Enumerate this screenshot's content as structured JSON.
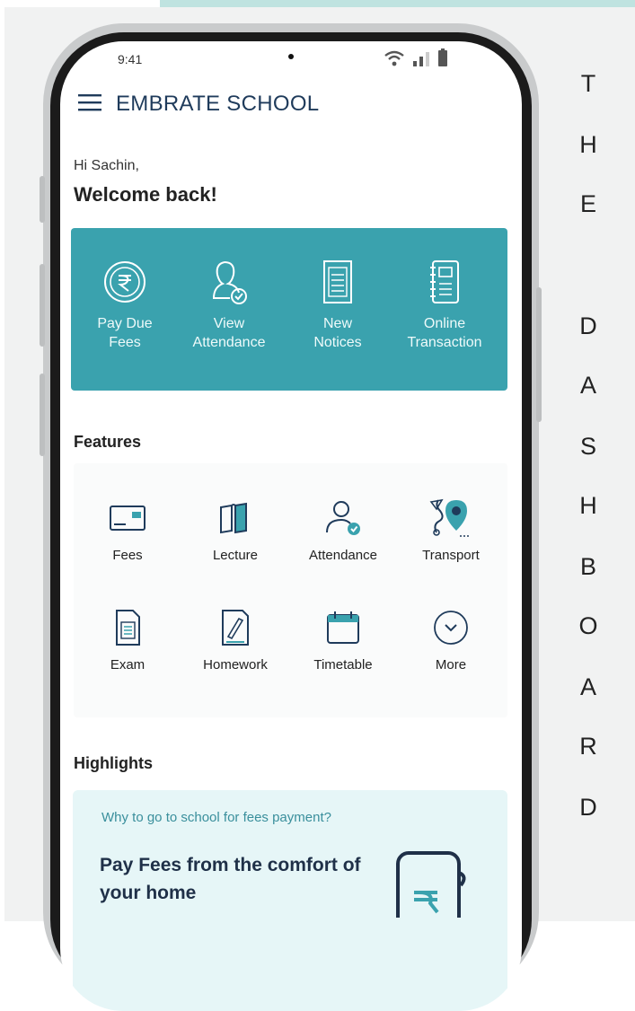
{
  "status_bar": {
    "time": "9:41"
  },
  "app": {
    "title": "EMBRATE SCHOOL"
  },
  "greeting": {
    "hi": "Hi Sachin,",
    "welcome": "Welcome back!"
  },
  "quick_actions": [
    {
      "label": "Pay Due\nFees",
      "icon": "rupee-circle-icon"
    },
    {
      "label": "View\nAttendance",
      "icon": "user-check-icon"
    },
    {
      "label": "New\nNotices",
      "icon": "notice-document-icon"
    },
    {
      "label": "Online\nTransaction",
      "icon": "ledger-book-icon"
    }
  ],
  "features": {
    "title": "Features",
    "items": [
      {
        "label": "Fees",
        "icon": "card-icon"
      },
      {
        "label": "Lecture",
        "icon": "book-icon"
      },
      {
        "label": "Attendance",
        "icon": "user-check-icon"
      },
      {
        "label": "Transport",
        "icon": "location-pin-icon"
      },
      {
        "label": "Exam",
        "icon": "exam-sheet-icon"
      },
      {
        "label": "Homework",
        "icon": "homework-pen-icon"
      },
      {
        "label": "Timetable",
        "icon": "calendar-icon"
      },
      {
        "label": "More",
        "icon": "chevron-down-circle-icon"
      }
    ]
  },
  "highlights": {
    "title": "Highlights",
    "question": "Why to go to school for fees payment?",
    "headline": "Pay Fees from the comfort of your home"
  },
  "side_text": [
    "T",
    "H",
    "E",
    "D",
    "A",
    "S",
    "H",
    "B",
    "O",
    "A",
    "R",
    "D"
  ],
  "colors": {
    "accent": "#3aa2ae",
    "highlight_bg": "#e6f6f7",
    "title": "#1f3b5b"
  }
}
